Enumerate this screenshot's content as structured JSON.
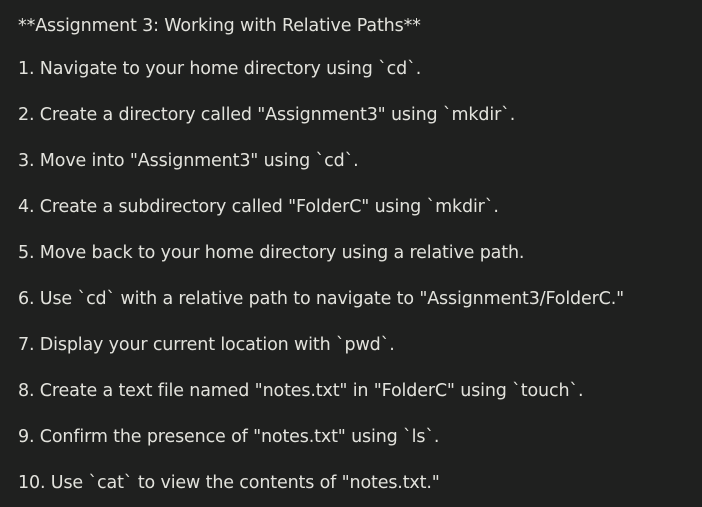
{
  "document": {
    "title": "**Assignment 3: Working with Relative Paths**",
    "steps": [
      "1. Navigate to your home directory using `cd`.",
      "2. Create a directory called \"Assignment3\" using `mkdir`.",
      "3. Move into \"Assignment3\" using `cd`.",
      "4. Create a subdirectory called \"FolderC\" using `mkdir`.",
      "5. Move back to your home directory using a relative path.",
      "6. Use `cd` with a relative path to navigate to \"Assignment3/FolderC.\"",
      "7. Display your current location with `pwd`.",
      "8. Create a text file named \"notes.txt\" in \"FolderC\" using `touch`.",
      "9. Confirm the presence of \"notes.txt\" using `ls`.",
      "10. Use `cat` to view the contents of \"notes.txt.\""
    ]
  },
  "colors": {
    "background": "#1f201f",
    "text": "#e2e2dc"
  }
}
